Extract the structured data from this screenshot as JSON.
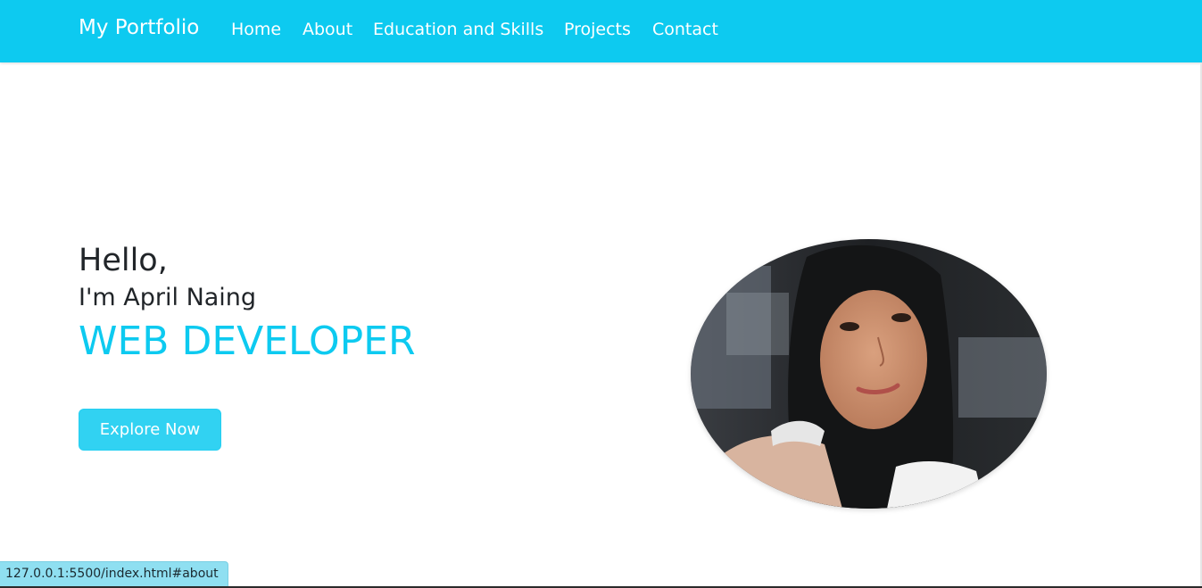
{
  "navbar": {
    "brand": "My Portfolio",
    "links": [
      {
        "label": "Home"
      },
      {
        "label": "About"
      },
      {
        "label": "Education and Skills"
      },
      {
        "label": "Projects"
      },
      {
        "label": "Contact"
      }
    ],
    "background_color": "#0dcaf0"
  },
  "hero": {
    "greeting": "Hello,",
    "intro": "I'm April Naing",
    "role": "WEB DEVELOPER",
    "cta_label": "Explore Now",
    "accent_color": "#0dcaf0",
    "photo_icon": "profile-photo"
  },
  "status_bar": {
    "url": "127.0.0.1:5500/index.html#about"
  }
}
